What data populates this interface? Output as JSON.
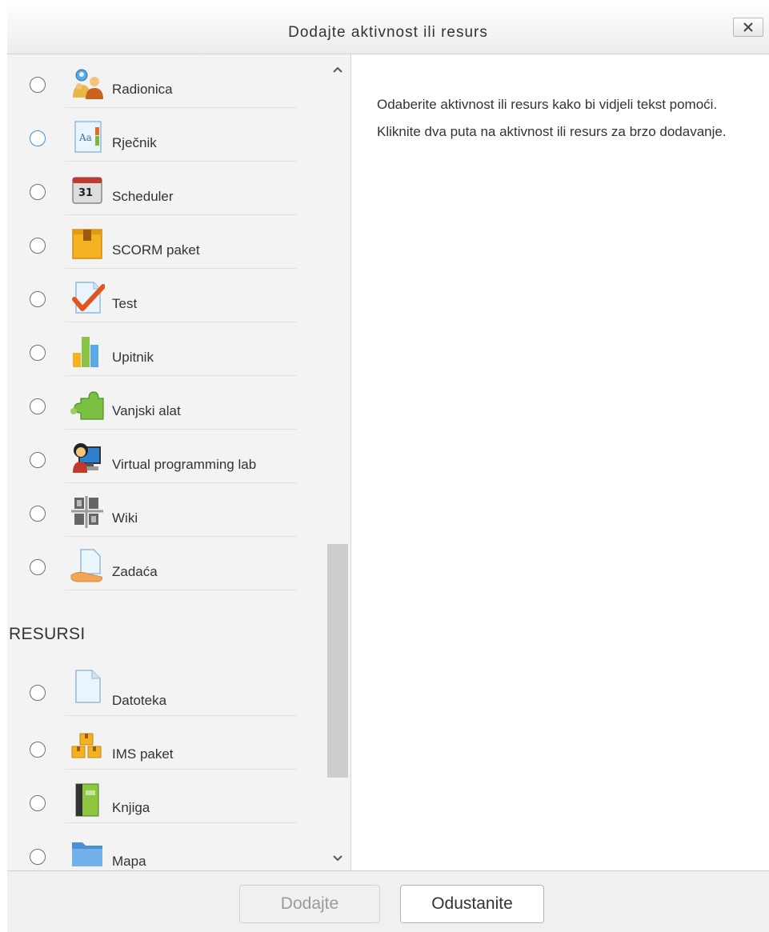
{
  "dialog": {
    "title": "Dodajte aktivnost ili resurs",
    "close_glyph": "✕"
  },
  "activities": [
    {
      "label": "Radionica",
      "icon": "workshop-icon"
    },
    {
      "label": "Rječnik",
      "icon": "glossary-icon"
    },
    {
      "label": "Scheduler",
      "icon": "calendar-icon",
      "icon_text": "31"
    },
    {
      "label": "SCORM paket",
      "icon": "scorm-package-icon"
    },
    {
      "label": "Test",
      "icon": "quiz-icon"
    },
    {
      "label": "Upitnik",
      "icon": "questionnaire-icon"
    },
    {
      "label": "Vanjski alat",
      "icon": "puzzle-icon"
    },
    {
      "label": "Virtual programming lab",
      "icon": "programming-lab-icon"
    },
    {
      "label": "Wiki",
      "icon": "wiki-icon"
    },
    {
      "label": "Zadaća",
      "icon": "assignment-icon"
    }
  ],
  "resources_heading": "RESURSI",
  "resources": [
    {
      "label": "Datoteka",
      "icon": "file-icon"
    },
    {
      "label": "IMS paket",
      "icon": "ims-package-icon"
    },
    {
      "label": "Knjiga",
      "icon": "book-icon"
    },
    {
      "label": "Mapa",
      "icon": "folder-icon"
    }
  ],
  "help": {
    "text": "Odaberite aktivnost ili resurs kako bi vidjeli tekst pomoći. Kliknite dva puta na aktivnost ili resurs za brzo dodavanje."
  },
  "footer": {
    "add_label": "Dodajte",
    "cancel_label": "Odustanite"
  },
  "colors": {
    "focus_radio": "#3b8ee8",
    "pane_bg": "#f3f3f3",
    "scroll_thumb": "#cdcdcd"
  }
}
